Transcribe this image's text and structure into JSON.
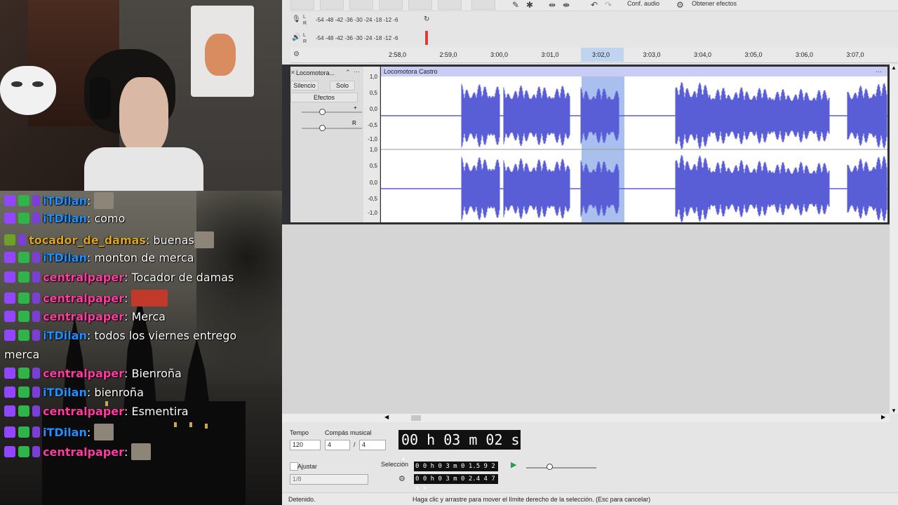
{
  "chat": {
    "messages": [
      {
        "name": "iTDilan",
        "text": "",
        "name_color": "#1e90ff",
        "emote": true
      },
      {
        "name": "iTDilan",
        "text": "como",
        "name_color": "#1e90ff",
        "emote": false
      },
      {
        "name": "tocador_de_damas",
        "text": "buenas",
        "name_color": "#daa520",
        "emote": true
      },
      {
        "name": "iTDilan",
        "text": "monton de merca",
        "name_color": "#1e90ff",
        "emote": false
      },
      {
        "name": "centralpaper",
        "text": "Tocador de damas",
        "name_color": "#ff3ba0",
        "emote": false
      },
      {
        "name": "centralpaper",
        "text": "",
        "name_color": "#ff3ba0",
        "emote": true
      },
      {
        "name": "centralpaper",
        "text": "Merca",
        "name_color": "#ff3ba0",
        "emote": false
      },
      {
        "name": "iTDilan",
        "text": "todos los viernes entrego",
        "name_color": "#1e90ff",
        "emote": false
      },
      {
        "name": "",
        "text": "merca",
        "name_color": "#ffffff",
        "emote": false
      },
      {
        "name": "centralpaper",
        "text": "Bienroña",
        "name_color": "#ff3ba0",
        "emote": false
      },
      {
        "name": "iTDilan",
        "text": "bienroña",
        "name_color": "#1e90ff",
        "emote": false
      },
      {
        "name": "centralpaper",
        "text": "Esmentira",
        "name_color": "#ff3ba0",
        "emote": false
      },
      {
        "name": "iTDilan",
        "text": "",
        "name_color": "#1e90ff",
        "emote": true
      },
      {
        "name": "centralpaper",
        "text": "",
        "name_color": "#ff3ba0",
        "emote": true
      }
    ]
  },
  "toolbar": {
    "conf_audio": "Conf. audio",
    "obtener_efectos": "Obtener efectos"
  },
  "meters": {
    "scale": "-54  -48  -42  -36  -30  -24  -18  -12   -6",
    "l": "L",
    "r": "R"
  },
  "timeline": {
    "ticks": [
      "2:58,0",
      "2:59,0",
      "3:00,0",
      "3:01,0",
      "3:02,0",
      "3:03,0",
      "3:04,0",
      "3:05,0",
      "3:06,0",
      "3:07,0"
    ]
  },
  "track": {
    "name": "Locomotora...",
    "clip_name": "Locomotora Castro",
    "silence": "Silencio",
    "solo": "Solo",
    "effects": "Efectos",
    "amp_labels": [
      "1,0",
      "0,5",
      "0,0",
      "-0,5",
      "-1,0",
      "1,0",
      "0,5",
      "0,0",
      "-0,5",
      "-1,0"
    ]
  },
  "bottom": {
    "tempo_label": "Tempo",
    "tempo_value": "120",
    "meter_label": "Compás musical",
    "meter_num": "4",
    "meter_sep": "/",
    "meter_den": "4",
    "big_time": "00 h 03 m 02 s",
    "snap_label": "Ajustar",
    "snap_value": "1/8",
    "selection_label": "Selección",
    "sel_start": "0 0 h 0 3 m 0 1.5 9 2 s",
    "sel_end": "0 0 h 0 3 m 0 2.4 4 7 s"
  },
  "status": {
    "state": "Detenido.",
    "hint": "Haga clic y arrastre para mover el límite derecho de la selección. (Esc para cancelar)"
  },
  "colors": {
    "waveform": "#5a5ed6",
    "selection": "#a9c0ef"
  }
}
